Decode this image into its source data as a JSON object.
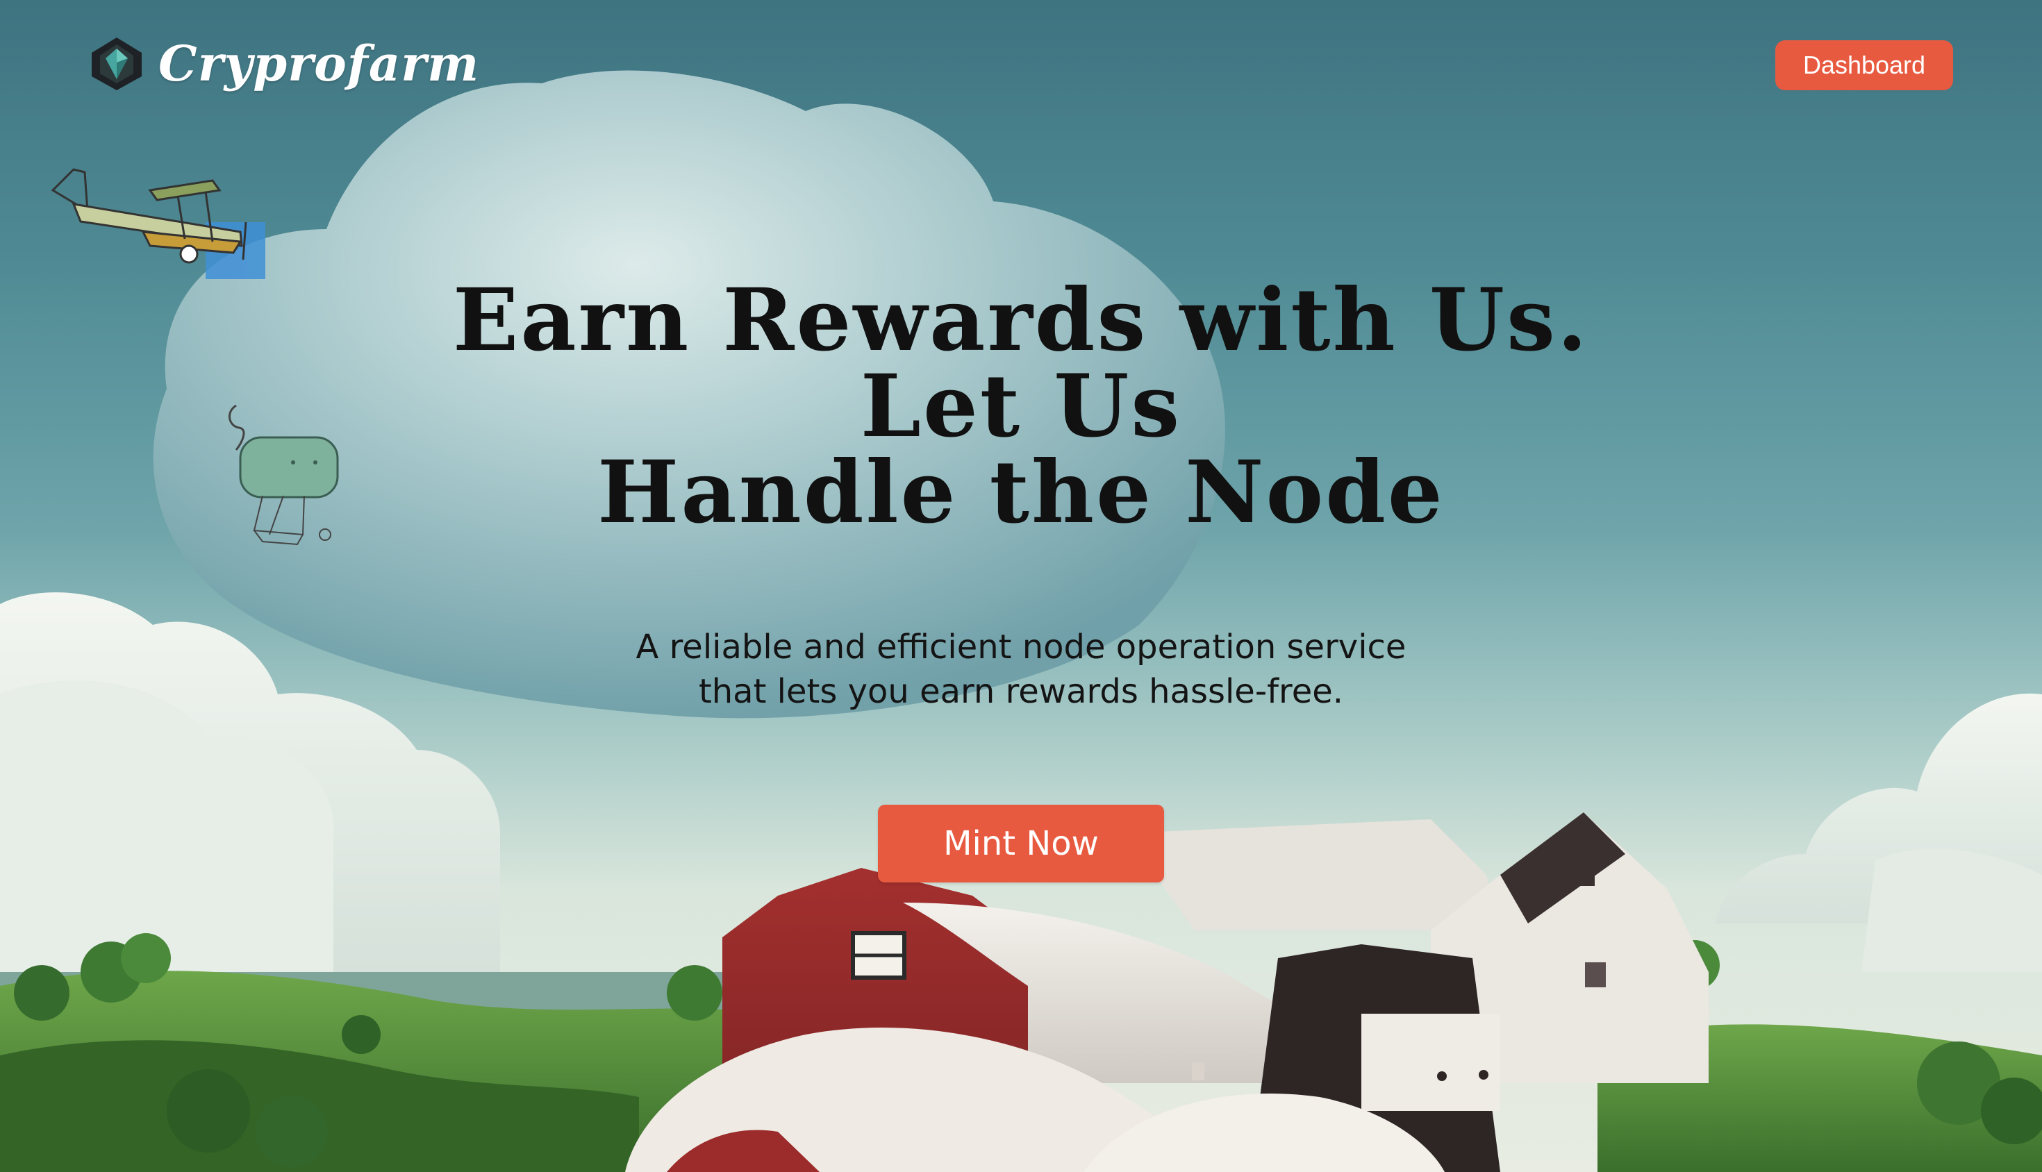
{
  "header": {
    "brand_name": "Cryprofarm",
    "logo_icon": "diamond-gem-icon",
    "dashboard_label": "Dashboard"
  },
  "hero": {
    "title_lines": [
      "Earn Rewards with Us.",
      "Let Us",
      "Handle the Node"
    ],
    "subtitle_lines": [
      "A reliable and efficient node operation service",
      "that lets you earn rewards hassle-free."
    ],
    "cta_label": "Mint Now"
  },
  "illustration": {
    "icons": [
      "biplane-icon",
      "floating-pet-icon"
    ],
    "scene": "farm-landscape-with-barns-and-clouds"
  },
  "colors": {
    "accent": "#e85a40",
    "sky_top": "#3e7380",
    "sky_bottom": "#e8ece2",
    "barn_red": "#8e2a2a",
    "grass": "#4f8a3a"
  }
}
